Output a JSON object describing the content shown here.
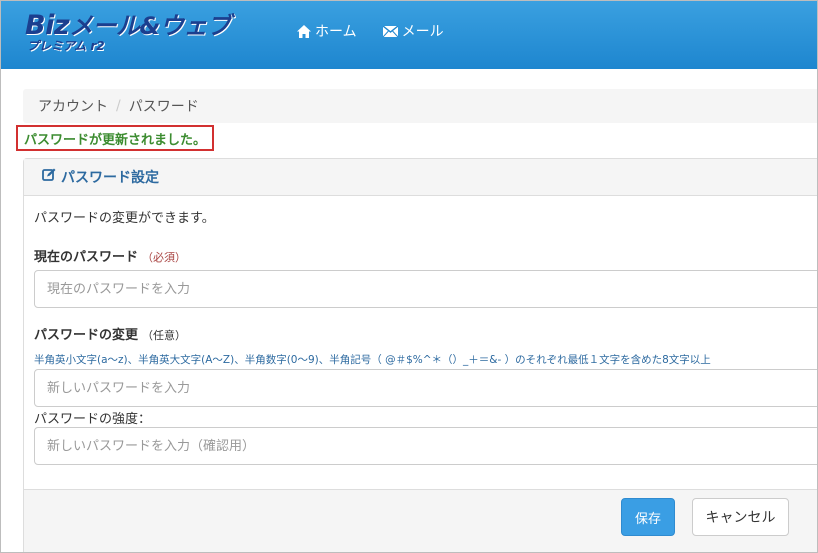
{
  "logo": {
    "main_biz": "Biz",
    "main_rest": "メール&ウェブ",
    "sub": "プレミアム r2"
  },
  "nav": [
    {
      "label": "ホーム",
      "icon": "home-icon"
    },
    {
      "label": "メール",
      "icon": "mail-icon"
    }
  ],
  "breadcrumb": {
    "items": [
      "アカウント",
      "パスワード"
    ],
    "separator": "/"
  },
  "flash": {
    "message": "パスワードが更新されました。"
  },
  "panel": {
    "title": "パスワード設定",
    "title_icon": "edit-icon",
    "description": "パスワードの変更ができます。",
    "current": {
      "label": "現在のパスワード",
      "required": "（必須）",
      "placeholder": "現在のパスワードを入力"
    },
    "change": {
      "label": "パスワードの変更",
      "optional": "（任意）",
      "hint": "半角英小文字(a〜z)、半角英大文字(A〜Z)、半角数字(0〜9)、半角記号（ @＃$%^＊（）_＋＝&- ）のそれぞれ最低１文字を含めた8文字以上",
      "placeholder": "新しいパスワードを入力"
    },
    "strength": {
      "label": "パスワードの強度：",
      "placeholder": "新しいパスワードを入力（確認用）"
    }
  },
  "buttons": {
    "save": "保存",
    "cancel": "キャンセル"
  },
  "colors": {
    "header": "#1e86cf",
    "accent": "#3a9ee4",
    "success": "#3c8c30",
    "flash_border": "#d23030",
    "required": "#a94442"
  }
}
